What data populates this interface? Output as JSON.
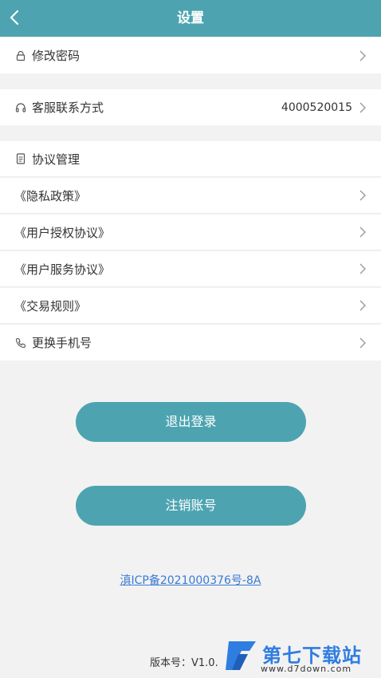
{
  "header": {
    "title": "设置",
    "back_icon": "chevron-left-icon"
  },
  "rows": {
    "change_password": {
      "label": "修改密码",
      "icon": "lock-icon"
    },
    "customer_service": {
      "label": "客服联系方式",
      "value": "4000520015",
      "icon": "headset-icon"
    },
    "agreements": {
      "label": "协议管理",
      "icon": "document-icon"
    },
    "privacy": {
      "label": "《隐私政策》"
    },
    "user_auth": {
      "label": "《用户授权协议》"
    },
    "user_service": {
      "label": "《用户服务协议》"
    },
    "trade_rules": {
      "label": "《交易规则》"
    },
    "change_phone": {
      "label": "更换手机号",
      "icon": "phone-icon"
    }
  },
  "buttons": {
    "logout": "退出登录",
    "deactivate": "注销账号"
  },
  "icp": "滇ICP备2021000376号-8A",
  "version": "版本号：V1.0.",
  "watermark": {
    "name": "第七下载站",
    "url": "www.d7down.com"
  },
  "colors": {
    "accent": "#4da4b0",
    "link": "#3a7bd5",
    "watermark": "#2f7de1"
  }
}
